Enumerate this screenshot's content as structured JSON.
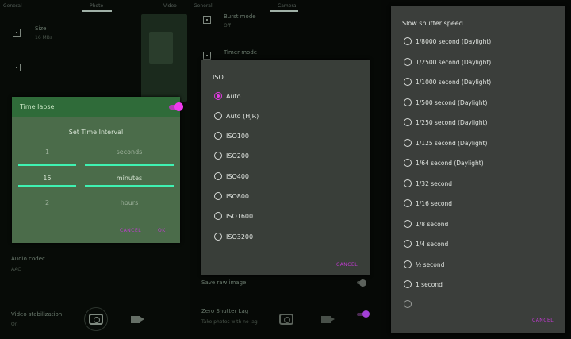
{
  "timelapse": {
    "title": "Time lapse",
    "subtitle": "Set Time Interval",
    "rows": [
      {
        "value": "1",
        "unit": "seconds"
      },
      {
        "value": "15",
        "unit": "minutes"
      },
      {
        "value": "2",
        "unit": "hours"
      }
    ],
    "cancel": "CANCEL",
    "ok": "OK",
    "enabled": true,
    "colors": {
      "header": "#2f6b39",
      "accent": "#3ff2b2",
      "toggle": "#ee3aee"
    }
  },
  "iso": {
    "title": "ISO",
    "selected": "Auto",
    "options": [
      "Auto",
      "Auto (HJR)",
      "ISO100",
      "ISO200",
      "ISO400",
      "ISO800",
      "ISO1600",
      "ISO3200"
    ],
    "cancel": "CANCEL"
  },
  "shutter": {
    "title": "Slow shutter speed",
    "options": [
      "1/8000 second (Daylight)",
      "1/2500 second (Daylight)",
      "1/1000 second (Daylight)",
      "1/500 second (Daylight)",
      "1/250 second (Daylight)",
      "1/125 second (Daylight)",
      "1/64 second (Daylight)",
      "1/32 second",
      "1/16 second",
      "1/8 second",
      "1/4 second",
      "½ second",
      "1 second"
    ],
    "cancel": "CANCEL"
  },
  "bg1": {
    "tabs": [
      "General",
      "Photo",
      "Video"
    ],
    "size_label": "Size",
    "size_value": "16 MBs",
    "audio_label": "Audio codec",
    "audio_value": "AAC",
    "stab_label": "Video stabilization",
    "stab_value": "On"
  },
  "bg2": {
    "tabs": [
      "General",
      "Camera"
    ],
    "burst_label": "Burst mode",
    "burst_value": "Off",
    "timer_label": "Timer mode",
    "save_label": "Save raw image",
    "zero_label": "Zero Shutter Lag",
    "zero_sub": "Take photos with no lag"
  }
}
